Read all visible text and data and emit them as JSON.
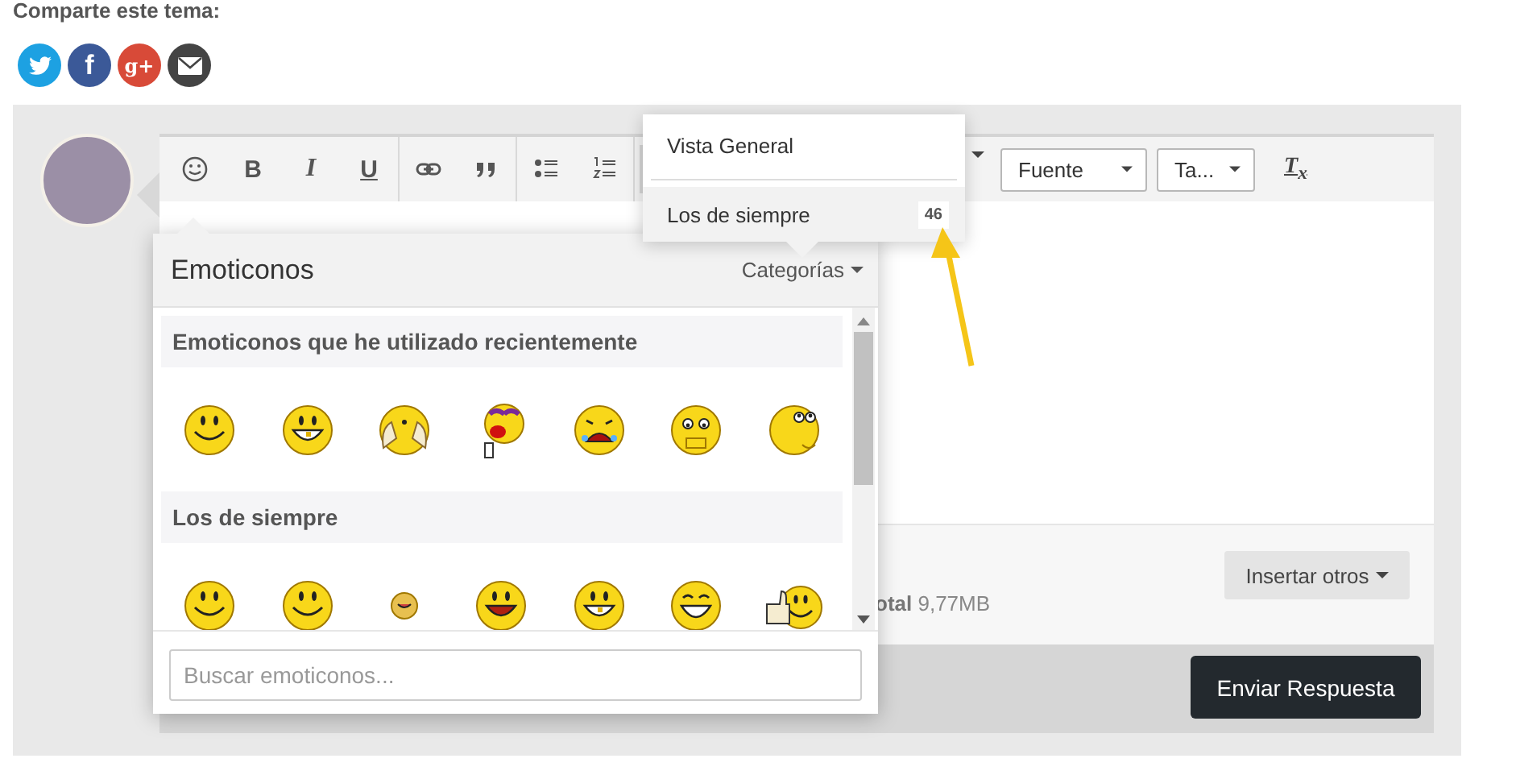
{
  "share": {
    "title": "Comparte este tema:",
    "buttons": [
      {
        "kind": "twitter"
      },
      {
        "kind": "facebook",
        "label": "f"
      },
      {
        "kind": "google",
        "label": "g+"
      },
      {
        "kind": "email"
      }
    ]
  },
  "toolbar": {
    "groups": [
      [
        {
          "kind": "emoji"
        },
        {
          "kind": "letter",
          "label": "B"
        },
        {
          "kind": "letter",
          "label": "I"
        },
        {
          "kind": "letter",
          "label": "U"
        }
      ],
      [
        {
          "kind": "link"
        },
        {
          "kind": "quote"
        }
      ],
      [
        {
          "kind": "bullets"
        },
        {
          "kind": "numbers"
        }
      ]
    ],
    "selects": [
      "Fuente",
      "Ta..."
    ],
    "clear_format": "T$_{x}$"
  },
  "footer": {
    "size_text": "**otal** 9,77MB",
    "insert_button": "Insertar otros"
  },
  "submit_button": "Enviar Respuesta",
  "emoji_panel": {
    "title": "Emoticonos",
    "categories_button": "Categorías",
    "sections": [
      {
        "title": "Emoticonos que he utilizado recientemente",
        "emoticons": [
          {
            "kind": "smile"
          },
          {
            "kind": "grin"
          },
          {
            "kind": "hands"
          },
          {
            "kind": "lipstick"
          },
          {
            "kind": "cry"
          },
          {
            "kind": "worried"
          },
          {
            "kind": "thinking"
          }
        ]
      },
      {
        "title": "Los de siempre",
        "emoticons": [
          {
            "kind": "smile"
          },
          {
            "kind": "smile"
          },
          {
            "kind": "small"
          },
          {
            "kind": "tongue"
          },
          {
            "kind": "grin"
          },
          {
            "kind": "laugh"
          },
          {
            "kind": "thumbs"
          }
        ]
      }
    ],
    "search": {
      "placeholder": "Buscar emoticonos..."
    }
  },
  "categories_menu": {
    "items": [
      {
        "label": "Vista General",
        "selected": false
      },
      {
        "label": "Los de siempre",
        "selected": true,
        "badge": "46"
      }
    ]
  }
}
